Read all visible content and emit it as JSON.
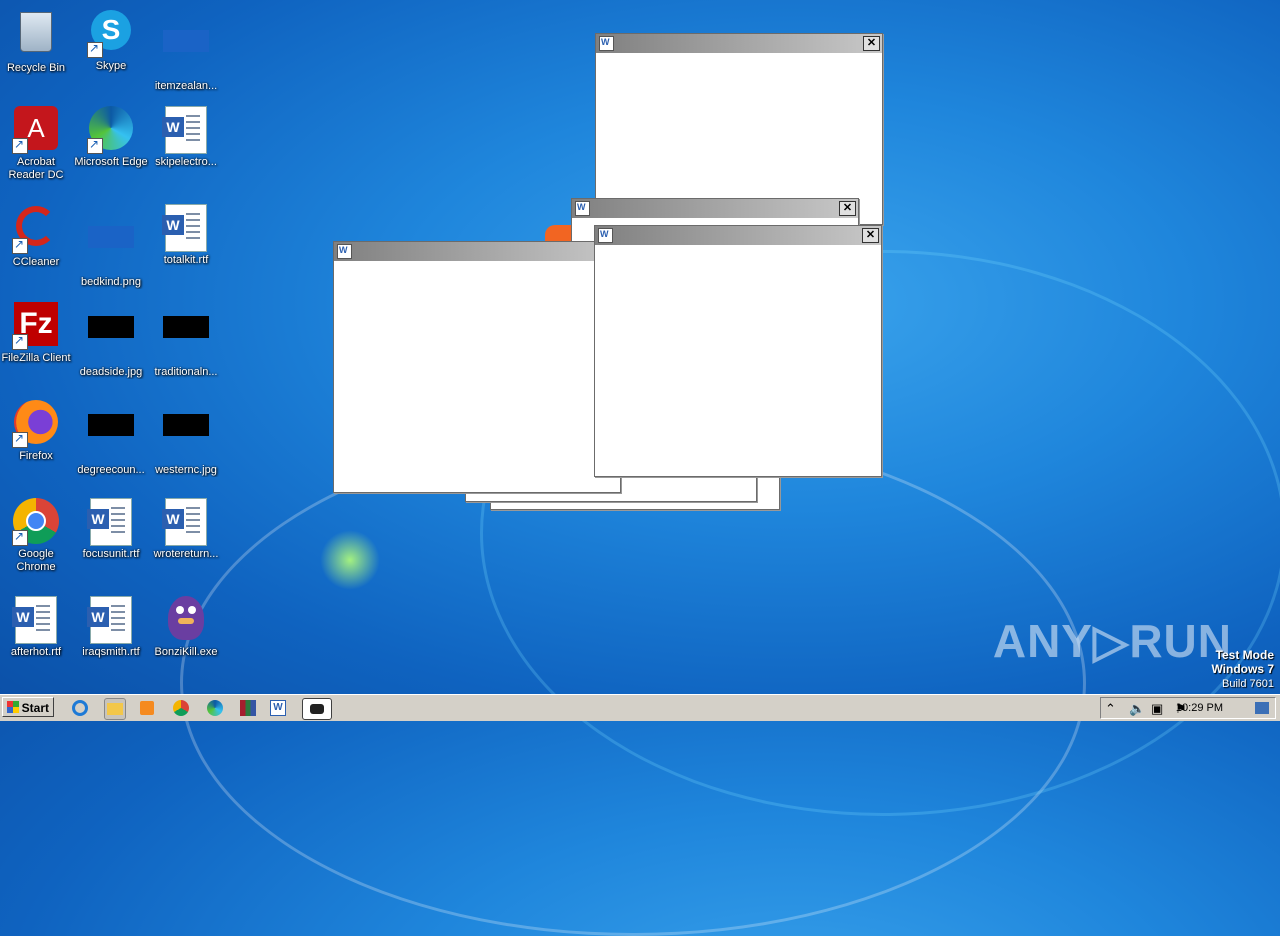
{
  "desktop_icons": [
    {
      "label": "Recycle Bin"
    },
    {
      "label": "Skype"
    },
    {
      "label": "itemzealan..."
    },
    {
      "label": "Acrobat Reader DC"
    },
    {
      "label": "Microsoft Edge"
    },
    {
      "label": "skipelectro..."
    },
    {
      "label": "CCleaner"
    },
    {
      "label": "bedkind.png"
    },
    {
      "label": "totalkit.rtf"
    },
    {
      "label": "FileZilla Client"
    },
    {
      "label": "deadside.jpg"
    },
    {
      "label": "traditionaln..."
    },
    {
      "label": "Firefox"
    },
    {
      "label": "degreecoun..."
    },
    {
      "label": "westernc.jpg"
    },
    {
      "label": "Google Chrome"
    },
    {
      "label": "focusunit.rtf"
    },
    {
      "label": "wrotereturn..."
    },
    {
      "label": "afterhot.rtf"
    },
    {
      "label": "iraqsmith.rtf"
    },
    {
      "label": "BonziKill.exe"
    }
  ],
  "windows": {
    "close_glyph": "✕"
  },
  "taskbar": {
    "start_label": "Start",
    "clock": "10:29 PM"
  },
  "watermark": {
    "brand": "ANY▷RUN",
    "line1": "Test Mode",
    "line2": "Windows 7",
    "line3": "Build 7601"
  }
}
